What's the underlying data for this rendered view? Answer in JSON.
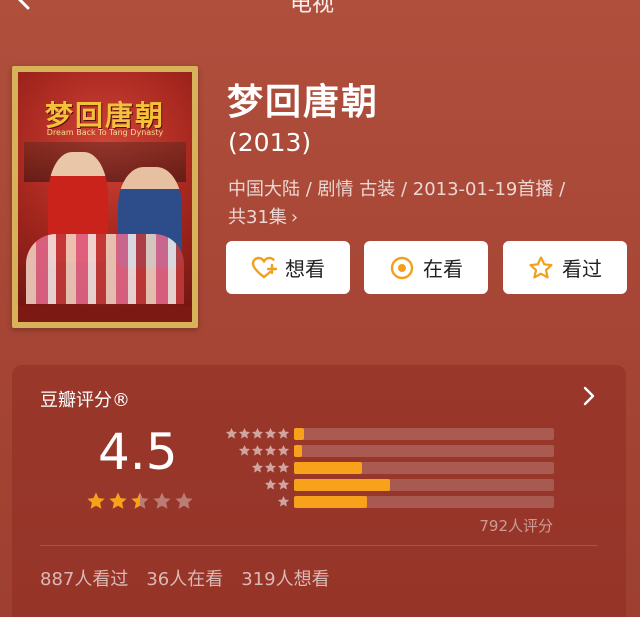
{
  "header": {
    "title": "电视"
  },
  "poster": {
    "title_art": "梦回唐朝",
    "subtitle_art": "Dream Back To Tang Dynasty"
  },
  "movie": {
    "title": "梦回唐朝",
    "year": "(2013)",
    "meta_line1": "中国大陆 / 剧情 古装 / 2013-01-19首播 /",
    "meta_line2": "共31集",
    "chevron": "›"
  },
  "actions": {
    "want_label": "想看",
    "watching_label": "在看",
    "watched_label": "看过"
  },
  "rating": {
    "title": "豆瓣评分®",
    "score": "4.5",
    "stars_value": 2.5,
    "stars_max": 5,
    "distribution": [
      {
        "stars": 5,
        "fraction": 0.04
      },
      {
        "stars": 4,
        "fraction": 0.03
      },
      {
        "stars": 3,
        "fraction": 0.26
      },
      {
        "stars": 2,
        "fraction": 0.37
      },
      {
        "stars": 1,
        "fraction": 0.28
      }
    ],
    "count_label": "792人评分"
  },
  "stats": {
    "watched": "887人看过",
    "watching": "36人在看",
    "want": "319人想看"
  },
  "colors": {
    "background": "#a94636",
    "accent": "#f7a21a",
    "button_bg": "#ffffff",
    "icon_orange": "#f2a01b"
  }
}
